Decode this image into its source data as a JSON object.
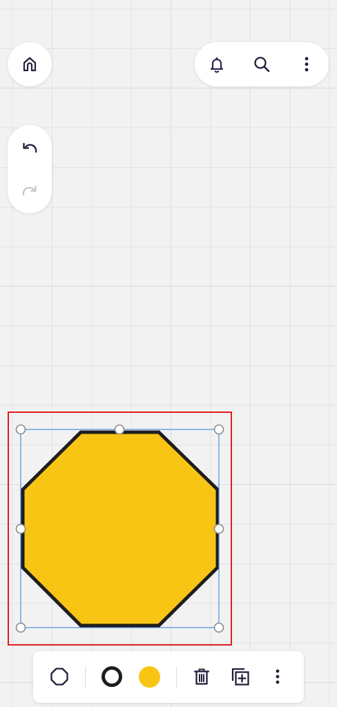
{
  "canvas": {
    "background": "#f2f2f2",
    "grid_line": "#e2e2e2",
    "grid_line_strong": "#dadada"
  },
  "top_left": {
    "home_icon": "home-icon"
  },
  "top_right": {
    "icons": [
      "bell-icon",
      "search-icon",
      "more-vertical-icon"
    ]
  },
  "history": {
    "undo_icon": "undo-icon",
    "redo_icon": "redo-icon",
    "redo_enabled": false
  },
  "selected_shape": {
    "type": "octagon",
    "fill_color": "#f9c515",
    "stroke_color": "#1e1e1e",
    "selection_color": "#4a90e2",
    "highlight_color": "#e01b1b"
  },
  "bottom_toolbar": {
    "items": [
      {
        "name": "shape-type",
        "icon": "octagon-icon"
      },
      {
        "name": "stroke-color",
        "icon": "ring-icon",
        "color": "#1e1e1e"
      },
      {
        "name": "fill-color",
        "icon": "circle-icon",
        "color": "#f9c515"
      },
      {
        "name": "delete",
        "icon": "trash-icon"
      },
      {
        "name": "duplicate",
        "icon": "duplicate-icon"
      },
      {
        "name": "more",
        "icon": "more-vertical-icon"
      }
    ]
  }
}
